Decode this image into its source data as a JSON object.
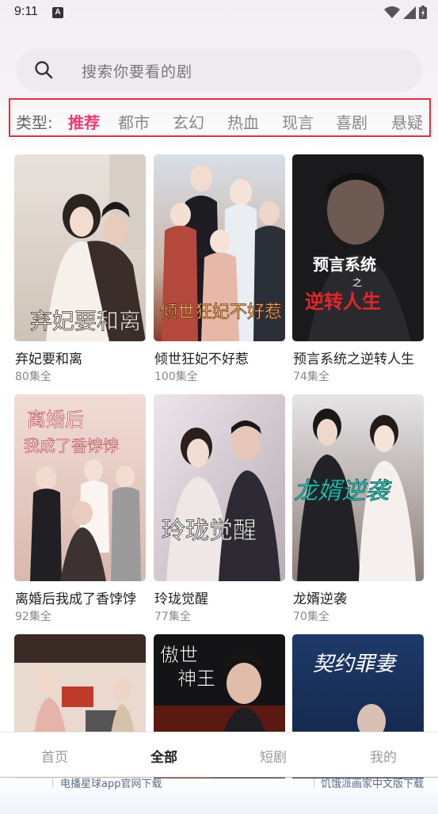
{
  "status_bar": {
    "time": "9:11",
    "badge": "A"
  },
  "search": {
    "placeholder": "搜索你要看的剧"
  },
  "categories": {
    "label": "类型:",
    "items": [
      "推荐",
      "都市",
      "玄幻",
      "热血",
      "现言",
      "喜剧",
      "悬疑"
    ],
    "active": "推荐",
    "accent_color": "#ee3b73",
    "highlight_border_color": "#d9333f"
  },
  "dramas": [
    {
      "title": "弃妃要和离",
      "episodes": "80集全",
      "poster_text": "弃妃要和离"
    },
    {
      "title": "倾世狂妃不好惹",
      "episodes": "100集全",
      "poster_text": "倾世狂妃不好惹"
    },
    {
      "title": "预言系统之逆转人生",
      "episodes": "74集全",
      "poster_text_1": "预言系统",
      "poster_text_2": "之",
      "poster_text_3": "逆转人生"
    },
    {
      "title": "离婚后我成了香饽饽",
      "episodes": "92集全",
      "poster_text_1": "离婚后",
      "poster_text_2": "我成了香饽饽"
    },
    {
      "title": "玲珑觉醒",
      "episodes": "77集全",
      "poster_text": "玲珑觉醒"
    },
    {
      "title": "龙婿逆袭",
      "episodes": "70集全",
      "poster_text": "龙婿逆袭"
    },
    {
      "title": "",
      "episodes": "",
      "poster_text": ""
    },
    {
      "title": "",
      "episodes": "",
      "poster_text_1": "傲世",
      "poster_text_2": "神王"
    },
    {
      "title": "",
      "episodes": "",
      "poster_text": "契约罪妻"
    }
  ],
  "bottom_nav": {
    "items": [
      "首页",
      "全部",
      "短剧",
      "我的"
    ],
    "active": "全部"
  },
  "footer": {
    "links": [
      "电播星球app官网下载",
      "饥饿派画家中文版下载"
    ]
  }
}
